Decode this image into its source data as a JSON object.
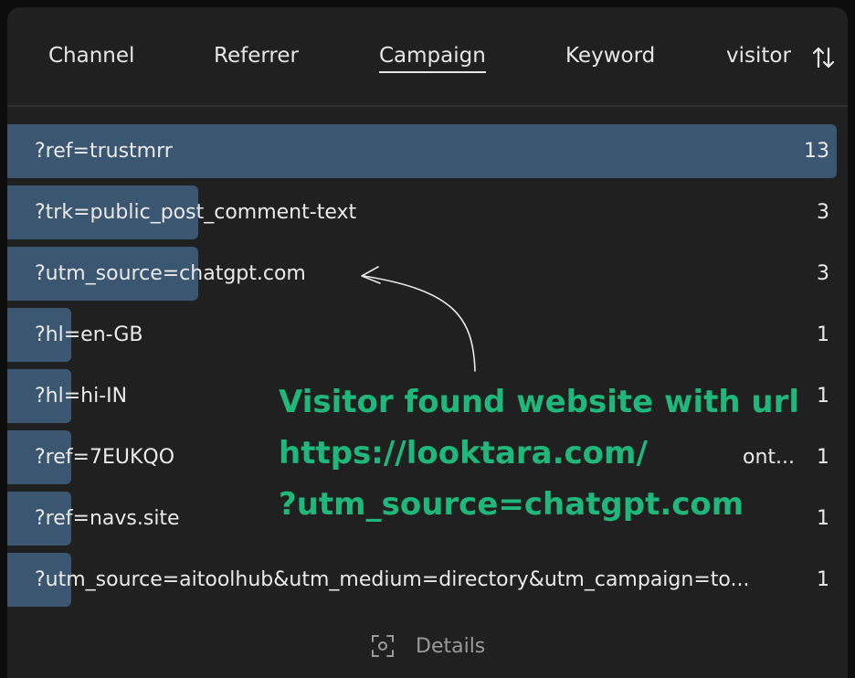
{
  "tabs": [
    {
      "label": "Channel"
    },
    {
      "label": "Referrer"
    },
    {
      "label": "Campaign",
      "active": true
    },
    {
      "label": "Keyword"
    },
    {
      "label": "visitor"
    }
  ],
  "rows": [
    {
      "label": "?ref=trustmrr",
      "count": "13",
      "share": 1.0
    },
    {
      "label": "?trk=public_post_comment-text",
      "count": "3",
      "share": 0.23
    },
    {
      "label": "?utm_source=chatgpt.com",
      "count": "3",
      "share": 0.23
    },
    {
      "label": "?hl=en-GB",
      "count": "1",
      "share": 0.077
    },
    {
      "label": "?hl=hi-IN",
      "count": "1",
      "share": 0.077
    },
    {
      "label": "?ref=7EUKQO",
      "count": "1",
      "share": 0.077
    },
    {
      "label": "?ref=navs.site",
      "count": "1",
      "share": 0.077
    },
    {
      "label": "?utm_source=aitoolhub&utm_medium=directory&utm_campaign=to...",
      "count": "1",
      "share": 0.077
    }
  ],
  "row6_tail": "ont...",
  "annotation": {
    "line1": "Visitor found website with url",
    "line2": "https://looktara.com/",
    "line3": "?utm_source=chatgpt.com",
    "color": "#1fb87a"
  },
  "details_label": "Details",
  "icons": {
    "sort": "sort-arrows-icon",
    "details": "focus-scan-icon"
  },
  "colors": {
    "bar": "#3a5670",
    "panel": "#202020"
  }
}
